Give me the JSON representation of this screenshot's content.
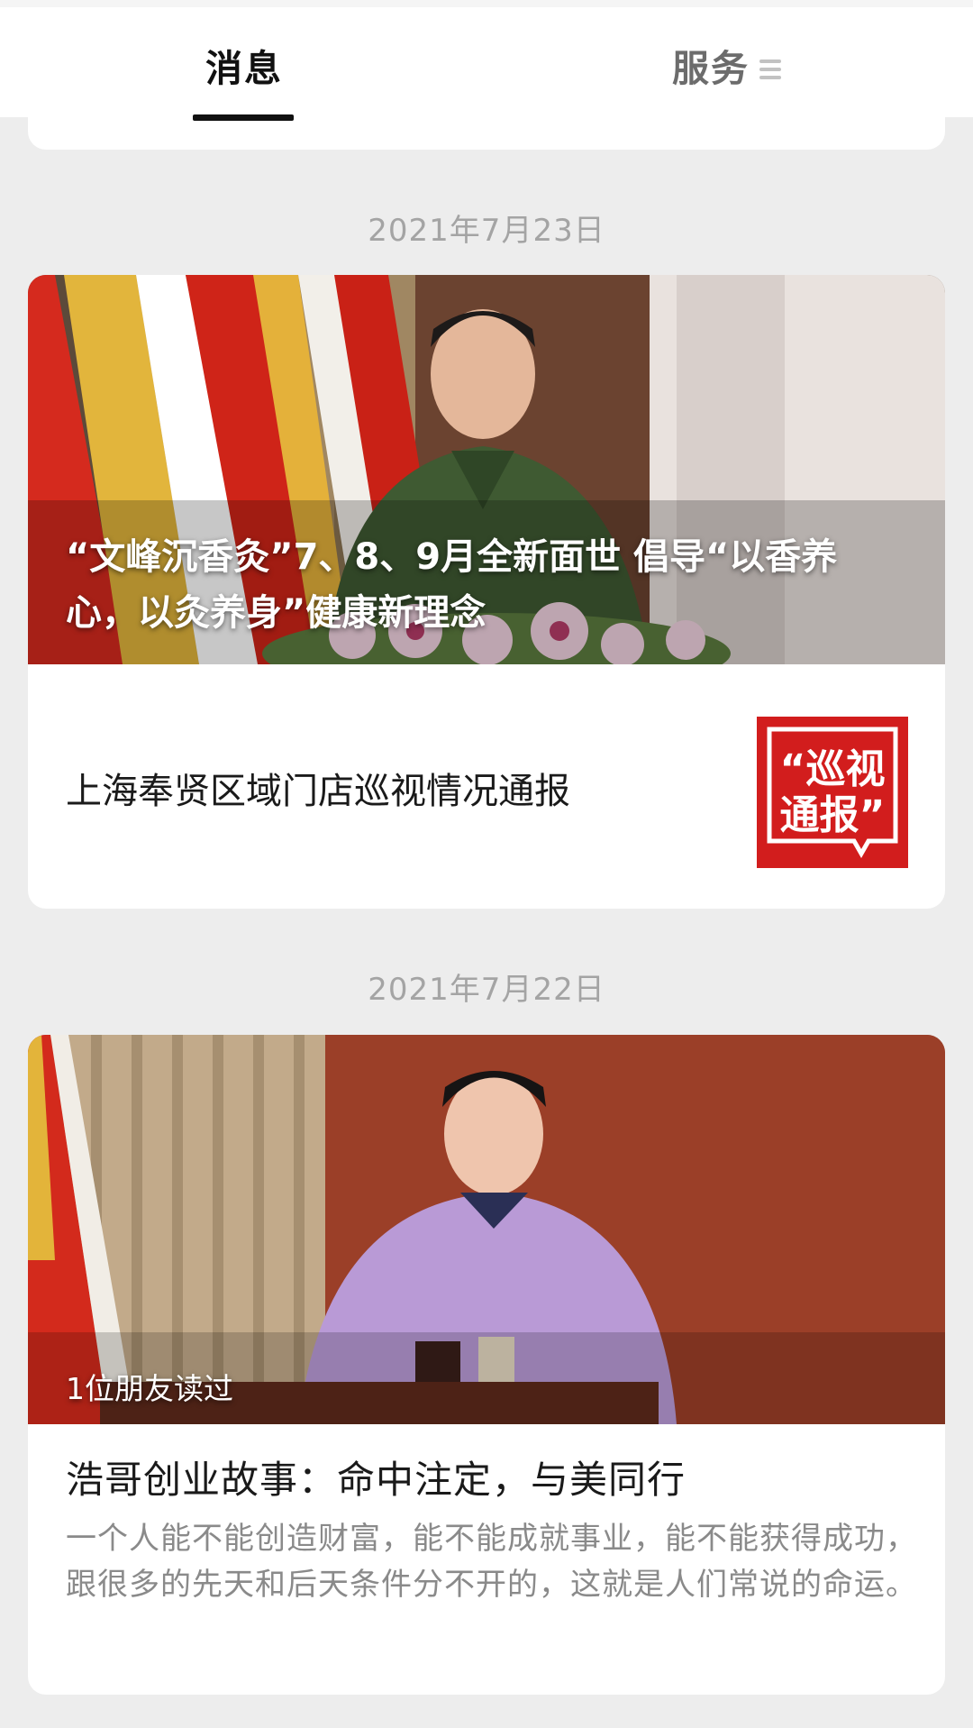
{
  "tabs": {
    "messages": "消息",
    "services": "服务"
  },
  "feed": [
    {
      "date": "2021年7月23日",
      "cover_caption": "“文峰沉香灸”7、8、9月全新面世 倡导“以香养心，以灸养身”健康新理念",
      "sub_article": {
        "title": "上海奉贤区域门店巡视情况通报",
        "thumb_text_line1": "“巡视",
        "thumb_text_line2": "通报”"
      }
    },
    {
      "date": "2021年7月22日",
      "read_badge": "1位朋友读过",
      "title": "浩哥创业故事：命中注定，与美同行",
      "summary": "一个人能不能创造财富，能不能成就事业，能不能获得成功，跟很多的先天和后天条件分不开的，这就是人们常说的命运。"
    }
  ],
  "colors": {
    "accent_red": "#d21d1d",
    "tab_active": "#111111",
    "tab_inactive": "#6c6c6c",
    "date_text": "#a4a4a4",
    "background": "#ededed"
  },
  "icons": {
    "menu": "menu-icon"
  }
}
